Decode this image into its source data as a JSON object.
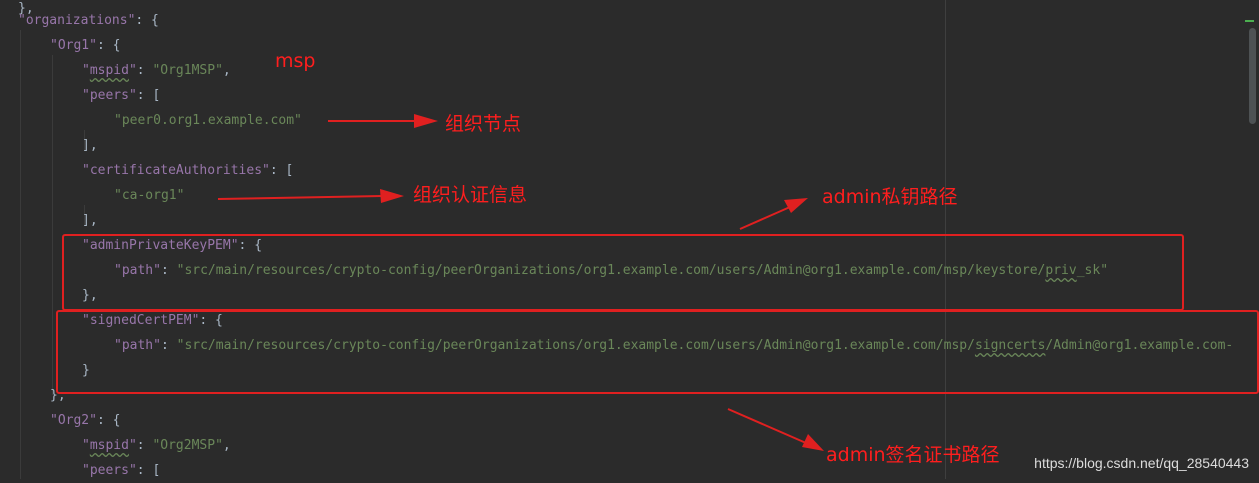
{
  "code": {
    "l0": {
      "k": "organizations",
      "rest": ": {"
    },
    "l1": {
      "k": "Org1",
      "rest": ": {"
    },
    "l2": {
      "k": "mspid",
      "v": "Org1MSP",
      "rest": ","
    },
    "l3": {
      "k": "peers",
      "rest": ": ["
    },
    "l4": {
      "v": "peer0.org1.example.com"
    },
    "l5": {
      "rest": "],"
    },
    "l6": {
      "k": "certificateAuthorities",
      "rest": ": ["
    },
    "l7": {
      "v": "ca-org1"
    },
    "l8": {
      "rest": "],"
    },
    "l9": {
      "k": "adminPrivateKeyPEM",
      "rest": ": {"
    },
    "l10": {
      "k": "path",
      "v_pre": "src/main/resources/crypto-config/peerOrganizations/org1.example.com/users/Admin@org1.example.com/msp/keystore/",
      "v_sq": "priv",
      "v_post": "_sk"
    },
    "l11": {
      "rest": "},"
    },
    "l12": {
      "k": "signedCertPEM",
      "rest": ": {"
    },
    "l13": {
      "k": "path",
      "v_pre": "src/main/resources/crypto-config/peerOrganizations/org1.example.com/users/Admin@org1.example.com/msp/",
      "v_sq": "signcerts",
      "v_post": "/Admin@org1.example.com-"
    },
    "l14": {
      "rest": "}"
    },
    "l15": {
      "rest": "},"
    },
    "l16": {
      "k": "Org2",
      "rest": ": {"
    },
    "l17": {
      "k": "mspid",
      "v": "Org2MSP",
      "rest": ","
    },
    "l18": {
      "k": "peers",
      "rest": ": ["
    }
  },
  "annotations": {
    "msp": "msp",
    "org_node": "组织节点",
    "org_auth": "组织认证信息",
    "admin_key": "admin私钥路径",
    "admin_cert": "admin签名证书路径"
  },
  "colors": {
    "background": "#2b2b2b",
    "key": "#9876aa",
    "string": "#6a8759",
    "punct": "#a9b7c6",
    "annotation": "#ff1e1e"
  },
  "watermark": "https://blog.csdn.net/qq_28540443"
}
